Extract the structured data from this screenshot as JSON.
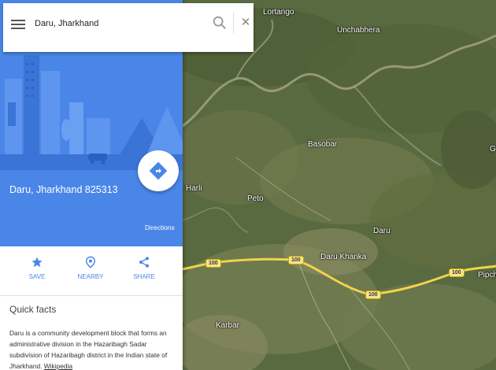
{
  "search": {
    "value": "Daru, Jharkhand"
  },
  "place": {
    "title": "Daru, Jharkhand 825313",
    "directions_label": "Directions"
  },
  "actions": [
    {
      "label": "SAVE",
      "icon": "star-icon"
    },
    {
      "label": "NEARBY",
      "icon": "location-pin-icon"
    },
    {
      "label": "SHARE",
      "icon": "share-icon"
    }
  ],
  "quick_facts": {
    "heading": "Quick facts",
    "text": "Daru is a community development block that forms an administrative division in the Hazaribagh Sadar subdivision of Hazaribagh district in the Indian state of Jharkhand.",
    "link_label": "Wikipedia"
  },
  "map": {
    "labels": [
      "Lortango",
      "Unchabhera",
      "Basobar",
      "Harli",
      "Peto",
      "Daru",
      "Daru Kharika",
      "Karbar",
      "Pipch",
      "G"
    ],
    "route_shields": [
      "100",
      "100",
      "100",
      "100"
    ]
  },
  "colors": {
    "accent": "#4a86e8",
    "route": "#f1d34a",
    "map_base": "#5b6b3f"
  }
}
